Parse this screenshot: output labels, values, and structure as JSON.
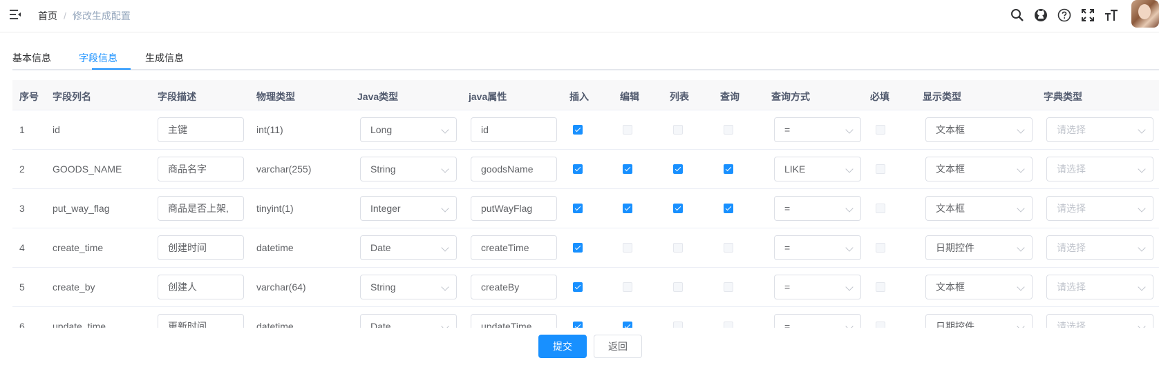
{
  "breadcrumb": {
    "home": "首页",
    "separator": "/",
    "current": "修改生成配置"
  },
  "toolbar_icons": [
    "search-icon",
    "github-icon",
    "question-icon",
    "fullscreen-icon",
    "font-size-icon"
  ],
  "tabs": [
    {
      "label": "基本信息",
      "active": false
    },
    {
      "label": "字段信息",
      "active": true
    },
    {
      "label": "生成信息",
      "active": false
    }
  ],
  "columns": [
    "序号",
    "字段列名",
    "字段描述",
    "物理类型",
    "Java类型",
    "java属性",
    "插入",
    "编辑",
    "列表",
    "查询",
    "查询方式",
    "必填",
    "显示类型",
    "字典类型"
  ],
  "rows": [
    {
      "no": "1",
      "name": "id",
      "desc": "主键",
      "phys": "int(11)",
      "java_type": "Long",
      "java_field": "id",
      "insert": true,
      "edit": false,
      "list": false,
      "query": false,
      "query_type": "=",
      "required": false,
      "html_type": "文本框",
      "dict": "请选择"
    },
    {
      "no": "2",
      "name": "GOODS_NAME",
      "desc": "商品名字",
      "phys": "varchar(255)",
      "java_type": "String",
      "java_field": "goodsName",
      "insert": true,
      "edit": true,
      "list": true,
      "query": true,
      "query_type": "LIKE",
      "required": false,
      "html_type": "文本框",
      "dict": "请选择"
    },
    {
      "no": "3",
      "name": "put_way_flag",
      "desc": "商品是否上架,",
      "phys": "tinyint(1)",
      "java_type": "Integer",
      "java_field": "putWayFlag",
      "insert": true,
      "edit": true,
      "list": true,
      "query": true,
      "query_type": "=",
      "required": false,
      "html_type": "文本框",
      "dict": "请选择"
    },
    {
      "no": "4",
      "name": "create_time",
      "desc": "创建时间",
      "phys": "datetime",
      "java_type": "Date",
      "java_field": "createTime",
      "insert": true,
      "edit": false,
      "list": false,
      "query": false,
      "query_type": "=",
      "required": false,
      "html_type": "日期控件",
      "dict": "请选择"
    },
    {
      "no": "5",
      "name": "create_by",
      "desc": "创建人",
      "phys": "varchar(64)",
      "java_type": "String",
      "java_field": "createBy",
      "insert": true,
      "edit": false,
      "list": false,
      "query": false,
      "query_type": "=",
      "required": false,
      "html_type": "文本框",
      "dict": "请选择"
    },
    {
      "no": "6",
      "name": "update_time",
      "desc": "更新时间",
      "phys": "datetime",
      "java_type": "Date",
      "java_field": "updateTime",
      "insert": true,
      "edit": true,
      "list": false,
      "query": false,
      "query_type": "=",
      "required": false,
      "html_type": "日期控件",
      "dict": "请选择"
    }
  ],
  "footer": {
    "submit": "提交",
    "back": "返回"
  },
  "colors": {
    "primary": "#1890ff",
    "header_bg": "#f8f8f9",
    "border": "#dcdfe6"
  }
}
